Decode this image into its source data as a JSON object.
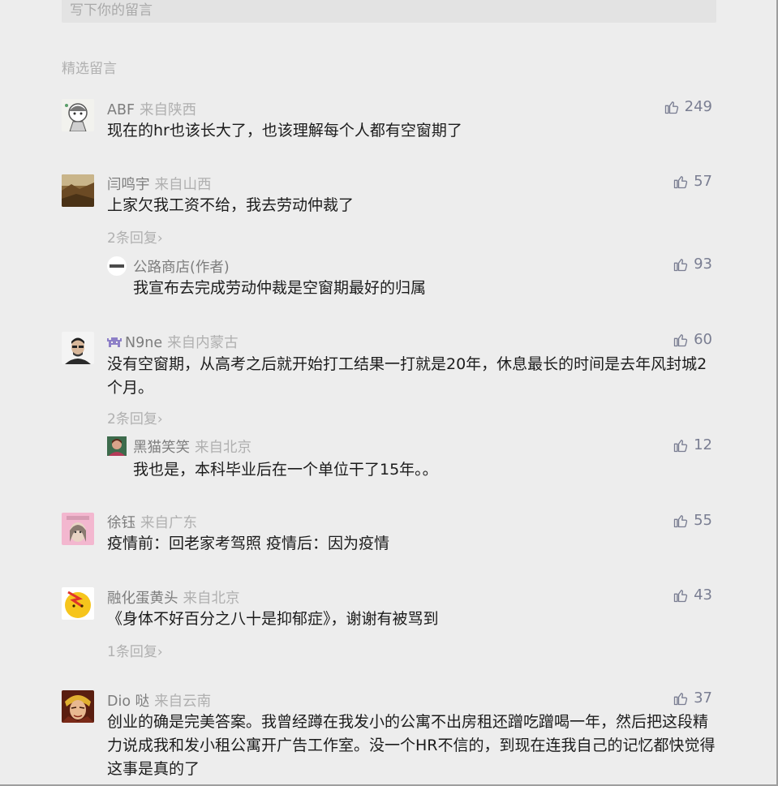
{
  "write_box": {
    "placeholder": "写下你的留言"
  },
  "section_title": "精选留言",
  "reply_arrow": "›",
  "colors": {
    "like": "#7a7e92",
    "nick": "#7d7d7d",
    "location": "#b0b0b0"
  },
  "comments": [
    {
      "nickname": "ABF",
      "location": "来自陕西",
      "likes": "249",
      "text": "现在的hr也该长大了，也该理解每个人都有空窗期了",
      "avatar": "cartoon-girl-avatar"
    },
    {
      "nickname": "闫鸣宇",
      "location": "来自山西",
      "likes": "57",
      "text": "上家欠我工资不给，我去劳动仲裁了",
      "replies_label": "2条回复",
      "avatar": "landscape-avatar",
      "reply": {
        "nickname": "公路商店(作者)",
        "likes": "93",
        "text": "我宣布去完成劳动仲裁是空窗期最好的归属",
        "avatar": "store-logo-avatar"
      }
    },
    {
      "nickname": "N9ne",
      "location": "来自内蒙古",
      "likes": "60",
      "text": "没有空窗期，从高考之后就开始打工结果一打就是20年，休息最长的时间是去年风封城2个月。",
      "replies_label": "2条回复",
      "avatar": "man-portrait-avatar",
      "badge": "game-invader-icon",
      "reply": {
        "nickname": "黑猫笑笑",
        "location": "来自北京",
        "likes": "12",
        "text": "我也是，本科毕业后在一个单位干了15年。。",
        "avatar": "woman-portrait-avatar"
      }
    },
    {
      "nickname": "徐钰",
      "location": "来自广东",
      "likes": "55",
      "text": "疫情前：回老家考驾照 疫情后：因为疫情",
      "avatar": "pink-cartoon-avatar"
    },
    {
      "nickname": "融化蛋黄头",
      "location": "来自北京",
      "likes": "43",
      "text": "《身体不好百分之八十是抑郁症》，谢谢有被骂到",
      "replies_label": "1条回复",
      "avatar": "egg-yolk-avatar"
    },
    {
      "nickname": "Dio 哒",
      "location": "来自云南",
      "likes": "37",
      "text": "创业的确是完美答案。我曾经蹲在我发小的公寓不出房租还蹭吃蹭喝一年，然后把这段精力说成我和发小租公寓开广告工作室。没一个HR不信的，到现在连我自己的记忆都快觉得这事是真的了",
      "avatar": "anime-character-avatar"
    }
  ]
}
